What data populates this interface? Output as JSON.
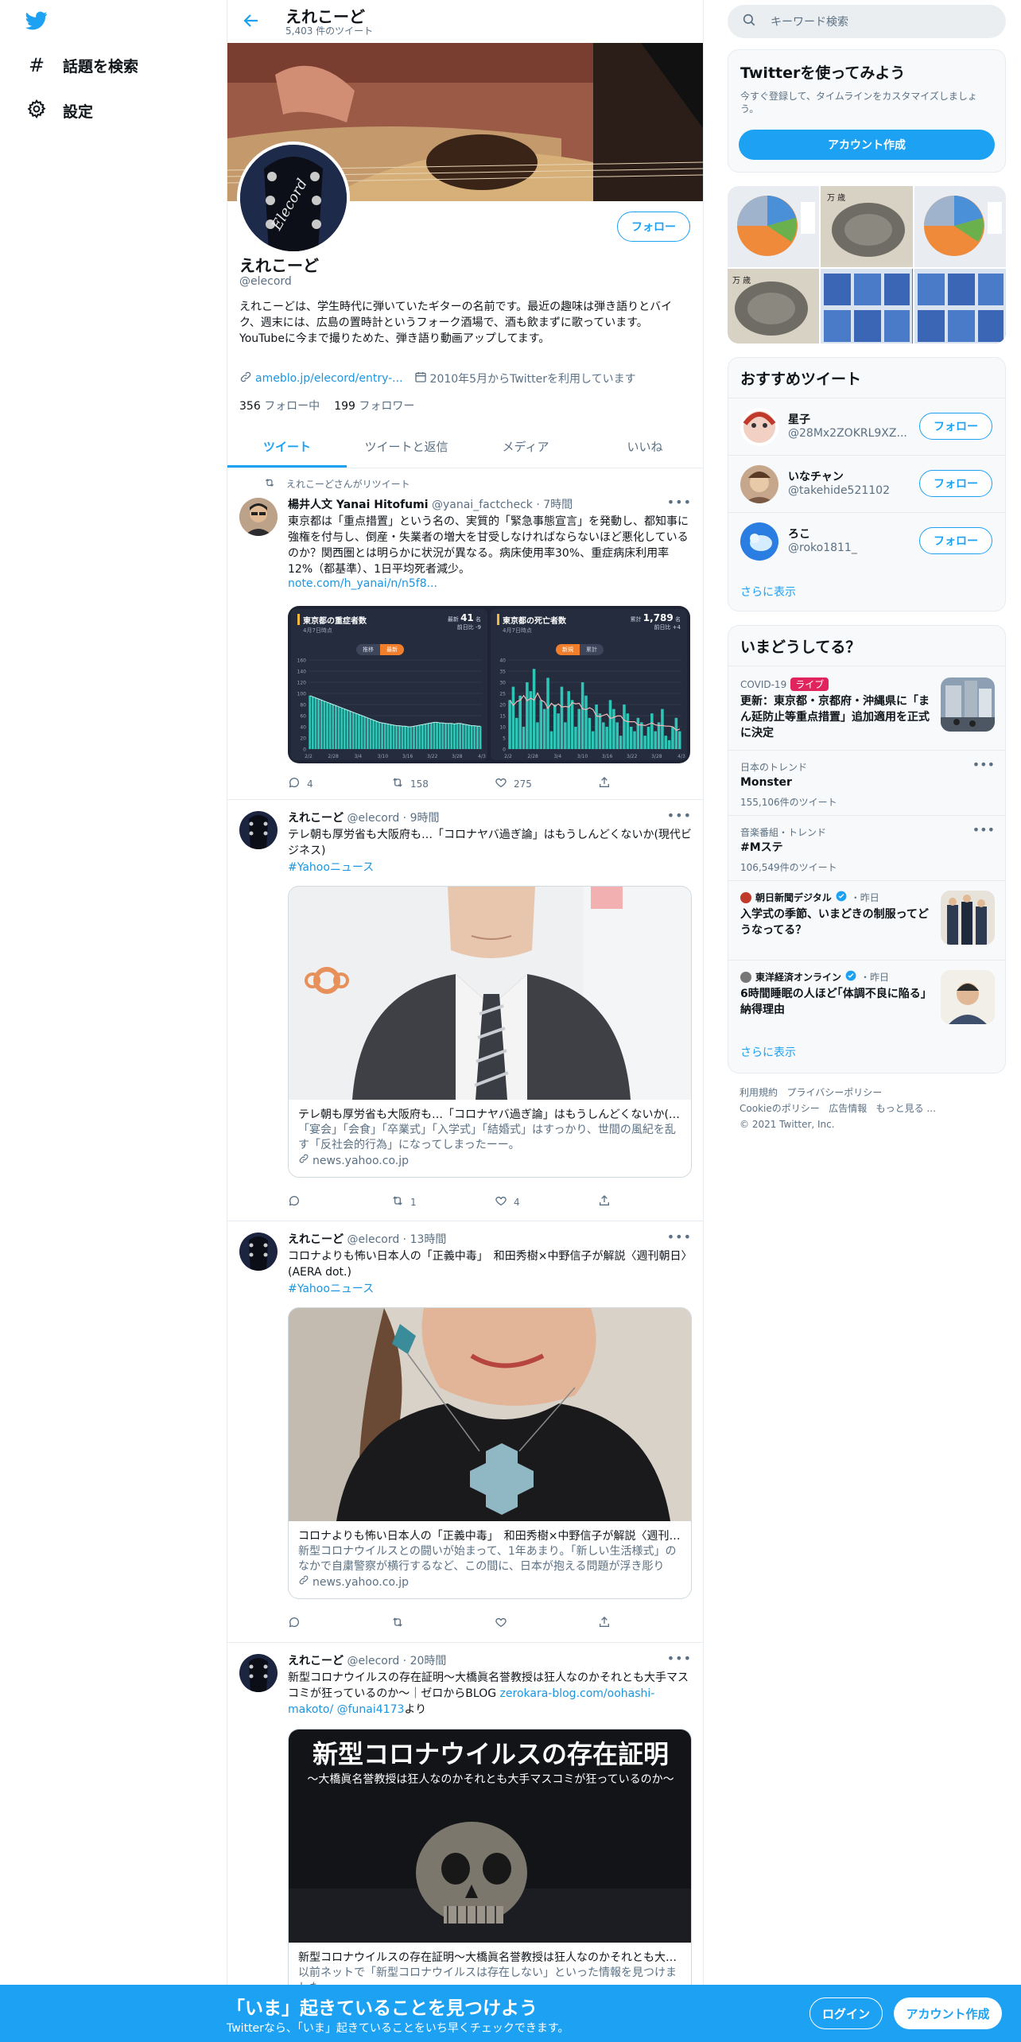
{
  "nav": {
    "explore": "話題を検索",
    "settings": "設定"
  },
  "header": {
    "title": "えれこーど",
    "tweet_count": "5,403 件のツイート"
  },
  "profile": {
    "name": "えれこーど",
    "handle": "@elecord",
    "follow": "フォロー",
    "bio": "えれこーどは、学生時代に弾いていたギターの名前です。最近の趣味は弾き語りとバイク、週末には、広島の置時計というフォーク酒場で、酒も飲まずに歌っています。\nYouTubeに今まで撮りためた、弾き語り動画アップしてます。",
    "link": "ameblo.jp/elecord/entry-...",
    "joined": "2010年5月からTwitterを利用しています",
    "following_count": "356",
    "following_label": "フォロー中",
    "followers_count": "199",
    "followers_label": "フォロワー"
  },
  "tabs": [
    "ツイート",
    "ツイートと返信",
    "メディア",
    "いいね"
  ],
  "tweets": [
    {
      "retweet_label": "えれこーどさんがリツイート",
      "name": "楊井人文 Yanai Hitofumi",
      "handle": "@yanai_factcheck",
      "time": "7時間",
      "text": "東京都は「重点措置」という名の、実質的「緊急事態宣言」を発動し、都知事に強権を付与し、倒産・失業者の増大を甘受しなければならないほど悪化しているのか？関西圏とは明らかに状況が異なる。病床使用率30%、重症病床利用率12%（都基準）、1日平均死者減少。",
      "link": "note.com/h_yanai/n/n5f8...",
      "replies": "4",
      "retweets": "158",
      "likes": "275"
    },
    {
      "name": "えれこーど",
      "handle": "@elecord",
      "time": "9時間",
      "text": "テレ朝も厚労省も大阪府も…「コロナヤバ過ぎ論」はもうしんどくないか(現代ビジネス)",
      "hashtag": "#Yahooニュース",
      "card_title": "テレ朝も厚労省も大阪府も…「コロナヤバ過ぎ論」はもうしんどくないか(現代ビジネス)",
      "card_desc": "「宴会」「会食」「卒業式」「入学式」「結婚式」はすっかり、世間の風紀を乱す「反社会的行為」になってしまったーー。",
      "card_domain": "news.yahoo.co.jp",
      "replies": "",
      "retweets": "1",
      "likes": "4"
    },
    {
      "name": "えれこーど",
      "handle": "@elecord",
      "time": "13時間",
      "text": "コロナよりも怖い日本人の「正義中毒」　和田秀樹×中野信子が解説〈週刊朝日〉(AERA dot.)",
      "hashtag": "#Yahooニュース",
      "card_title": "コロナよりも怖い日本人の「正義中毒」　和田秀樹×中野信子が解説〈週刊朝日〉(AERA dot.)",
      "card_desc": "新型コロナウイルスとの闘いが始まって、1年あまり。「新しい生活様式」のなかで自粛警察が横行するなど、この間に、日本が抱える問題が浮き彫りに…",
      "card_domain": "news.yahoo.co.jp",
      "replies": "",
      "retweets": "",
      "likes": ""
    },
    {
      "name": "えれこーど",
      "handle": "@elecord",
      "time": "20時間",
      "text_a": "新型コロナウイルスの存在証明～大橋眞名誉教授は狂人なのかそれとも大手マスコミが狂っているのか～｜ゼロからBLOG ",
      "link_a": "zerokara-blog.com/oohashi-makoto/",
      "mention": "@funai4173",
      "text_b": "より",
      "img_title": "新型コロナウイルスの存在証明",
      "img_sub": "～大橋眞名誉教授は狂人なのかそれとも大手マスコミが狂っているのか～",
      "card_title": "新型コロナウイルスの存在証明～大橋眞名誉教授は狂人なのかそれとも大手マスコミが狂っているのか～",
      "card_desc": "以前ネットで「新型コロナウイルスは存在しない」といった情報を見つけました。"
    }
  ],
  "chart1": {
    "title": "東京都の重症者数",
    "date": "4月7日時点",
    "total_label": "最新",
    "total": "41",
    "unit": "名",
    "diff": "前日比 -9",
    "toggle_a": "推移",
    "toggle_b": "最新"
  },
  "chart2": {
    "title": "東京都の死亡者数",
    "date": "4月7日時点",
    "total_label": "累計",
    "total": "1,789",
    "unit": "名",
    "diff": "前日比 +4",
    "toggle_a": "新規",
    "toggle_b": "累計"
  },
  "chart_data": [
    {
      "type": "bar",
      "title": "東京都の重症者数",
      "ylim": [
        0,
        160
      ],
      "yticks": [
        "160",
        "140",
        "120",
        "100",
        "80",
        "60",
        "40",
        "20",
        "0"
      ],
      "xticks": [
        "2/2",
        "2/28",
        "3/4",
        "3/10",
        "3/16",
        "3/22",
        "3/28",
        "4/3"
      ],
      "values": [
        96,
        94,
        92,
        90,
        88,
        86,
        84,
        82,
        80,
        78,
        76,
        74,
        72,
        70,
        68,
        66,
        64,
        62,
        60,
        58,
        56,
        54,
        52,
        50,
        48,
        47,
        46,
        45,
        44,
        43,
        42,
        42,
        41,
        41,
        40,
        40,
        41,
        42,
        43,
        44,
        45,
        46,
        47,
        48,
        48,
        47,
        47,
        46,
        46,
        46,
        45,
        46,
        46,
        45,
        44,
        43,
        42,
        42,
        41,
        41
      ]
    },
    {
      "type": "bar",
      "title": "東京都の死亡者数",
      "ylim": [
        0,
        40
      ],
      "yticks": [
        "40",
        "35",
        "30",
        "25",
        "20",
        "15",
        "10",
        "5",
        "0"
      ],
      "xticks": [
        "2/2",
        "2/28",
        "3/4",
        "3/10",
        "3/16",
        "3/22",
        "3/28",
        "4/3"
      ],
      "values": [
        22,
        28,
        14,
        24,
        10,
        30,
        26,
        36,
        12,
        22,
        18,
        32,
        8,
        20,
        16,
        28,
        12,
        26,
        22,
        10,
        18,
        30,
        24,
        14,
        8,
        20,
        16,
        12,
        10,
        22,
        18,
        12,
        6,
        20,
        16,
        10,
        8,
        14,
        12,
        6,
        10,
        16,
        8,
        12,
        18,
        6,
        4,
        10,
        14,
        8
      ]
    }
  ],
  "right": {
    "search_placeholder": "キーワード検索",
    "signup_title": "Twitterを使ってみよう",
    "signup_desc": "今すぐ登録して、タイムラインをカスタマイズしましょう。",
    "signup_button": "アカウント作成",
    "rec_title": "おすすめツイート",
    "recs": [
      {
        "name": "星子",
        "handle": "@28Mx2ZOKRL9XZ...",
        "follow": "フォロー"
      },
      {
        "name": "いなチャン",
        "handle": "@takehide521102",
        "follow": "フォロー"
      },
      {
        "name": "ろこ",
        "handle": "@roko1811_",
        "follow": "フォロー"
      }
    ],
    "rec_more": "さらに表示",
    "trend_title": "いまどうしてる？",
    "trends": [
      {
        "cat": "COVID-19",
        "live": "ライブ",
        "title": "更新：東京都・京都府・沖縄県に「まん延防止等重点措置」追加適用を正式に決定"
      },
      {
        "cat": "日本のトレンド",
        "title": "Monster",
        "count": "155,106件のツイート"
      },
      {
        "cat": "音楽番組・トレンド",
        "title": "#Mステ",
        "count": "106,549件のツイート"
      },
      {
        "source": "朝日新聞デジタル",
        "time": "・昨日",
        "title": "入学式の季節、いまどきの制服ってどうなってる？"
      },
      {
        "source": "東洋経済オンライン",
        "time": "・昨日",
        "title": "6時間睡眠の人ほど｢体調不良に陥る｣納得理由"
      }
    ],
    "trend_more": "さらに表示",
    "footer": {
      "l1a": "利用規約",
      "l1b": "プライバシーポリシー",
      "l2a": "Cookieのポリシー",
      "l2b": "広告情報",
      "l2c": "もっと見る ...",
      "l3": "© 2021 Twitter, Inc."
    }
  },
  "bottom": {
    "title": "「いま」起きていることを見つけよう",
    "sub": "Twitterなら、「いま」起きていることをいち早くチェックできます。",
    "login": "ログイン",
    "signup": "アカウント作成"
  },
  "colors": {
    "accent": "#1da1f2",
    "text": "#0f1419",
    "muted": "#5b7083",
    "border": "#e6ecf0",
    "bar": "#2ec4b6"
  }
}
